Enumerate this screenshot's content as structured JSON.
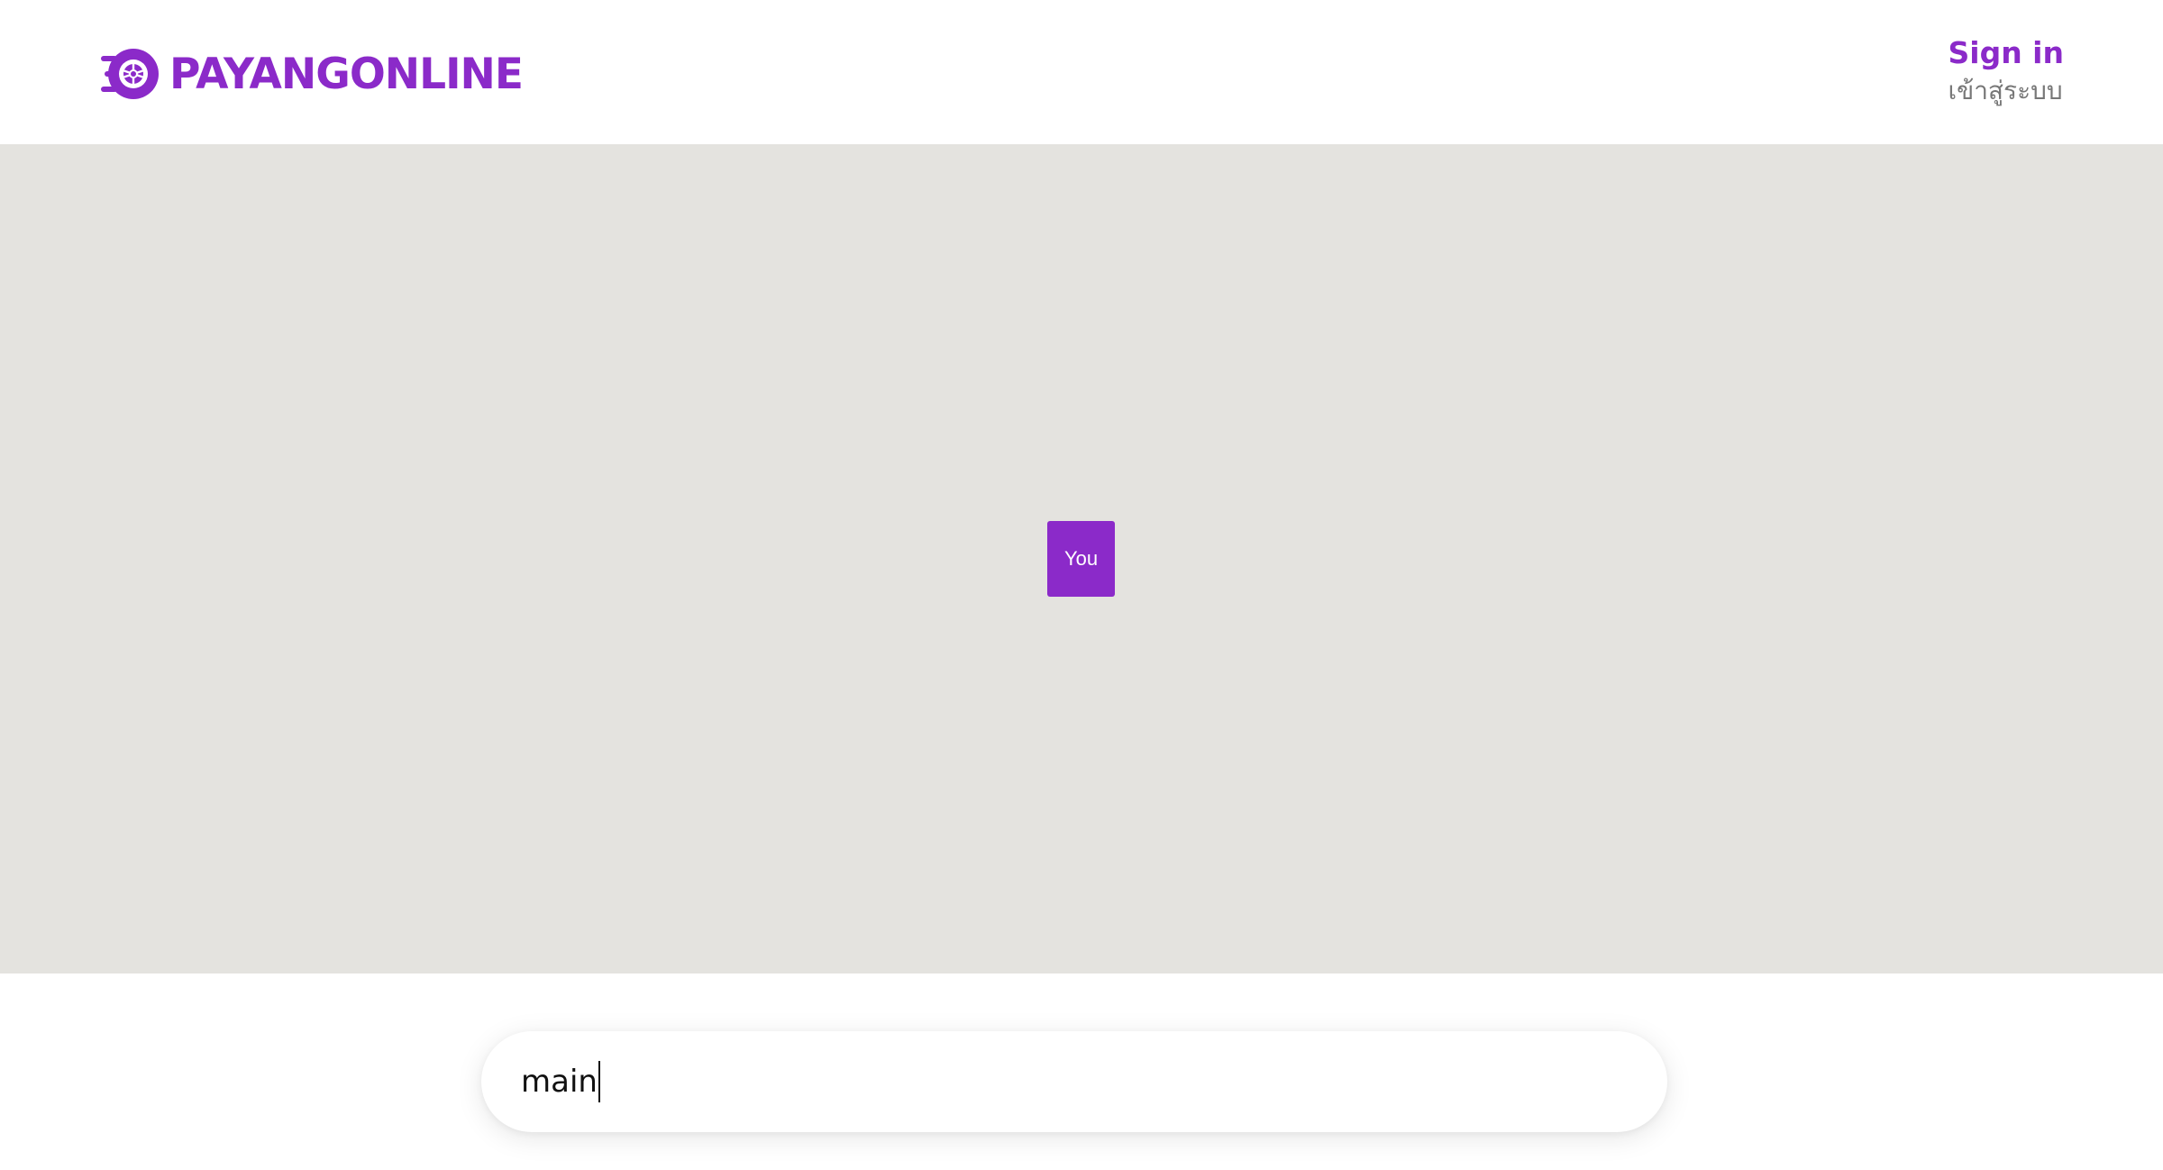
{
  "colors": {
    "brand": "#8b2ac9",
    "map_background": "#e4e3df",
    "secondary_text": "#777777"
  },
  "header": {
    "logo_text": "PAYANGONLINE",
    "logo_icon": "tire-speed-icon",
    "signin_label": "Sign in",
    "signin_label_th": "เข้าสู่ระบบ"
  },
  "map": {
    "marker_label": "You"
  },
  "search": {
    "value": "main"
  }
}
